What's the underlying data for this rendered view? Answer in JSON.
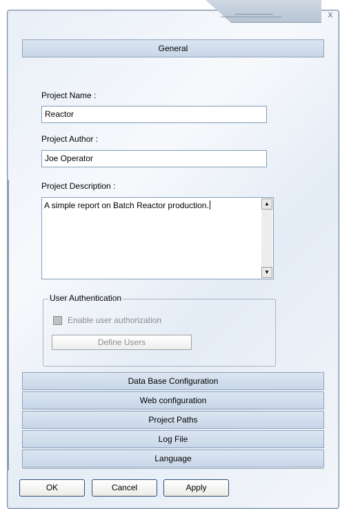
{
  "window": {
    "close_glyph": "x"
  },
  "general": {
    "header": "General",
    "project_name_label": "Project Name :",
    "project_name_value": "Reactor",
    "project_author_label": "Project Author :",
    "project_author_value": "Joe Operator",
    "project_description_label": "Project Description :",
    "project_description_value": "A simple report on Batch Reactor production.",
    "user_auth": {
      "title": "User Authentication",
      "enable_label": "Enable user authorization",
      "enable_checked": false,
      "enabled": false,
      "define_users_label": "Define Users"
    }
  },
  "sections": [
    {
      "label": "Data Base Configuration"
    },
    {
      "label": "Web configuration"
    },
    {
      "label": "Project Paths"
    },
    {
      "label": "Log File"
    },
    {
      "label": "Language"
    }
  ],
  "buttons": {
    "ok": "OK",
    "cancel": "Cancel",
    "apply": "Apply"
  },
  "icons": {
    "scroll_up": "scroll-up-arrow-icon",
    "scroll_down": "scroll-down-arrow-icon"
  }
}
